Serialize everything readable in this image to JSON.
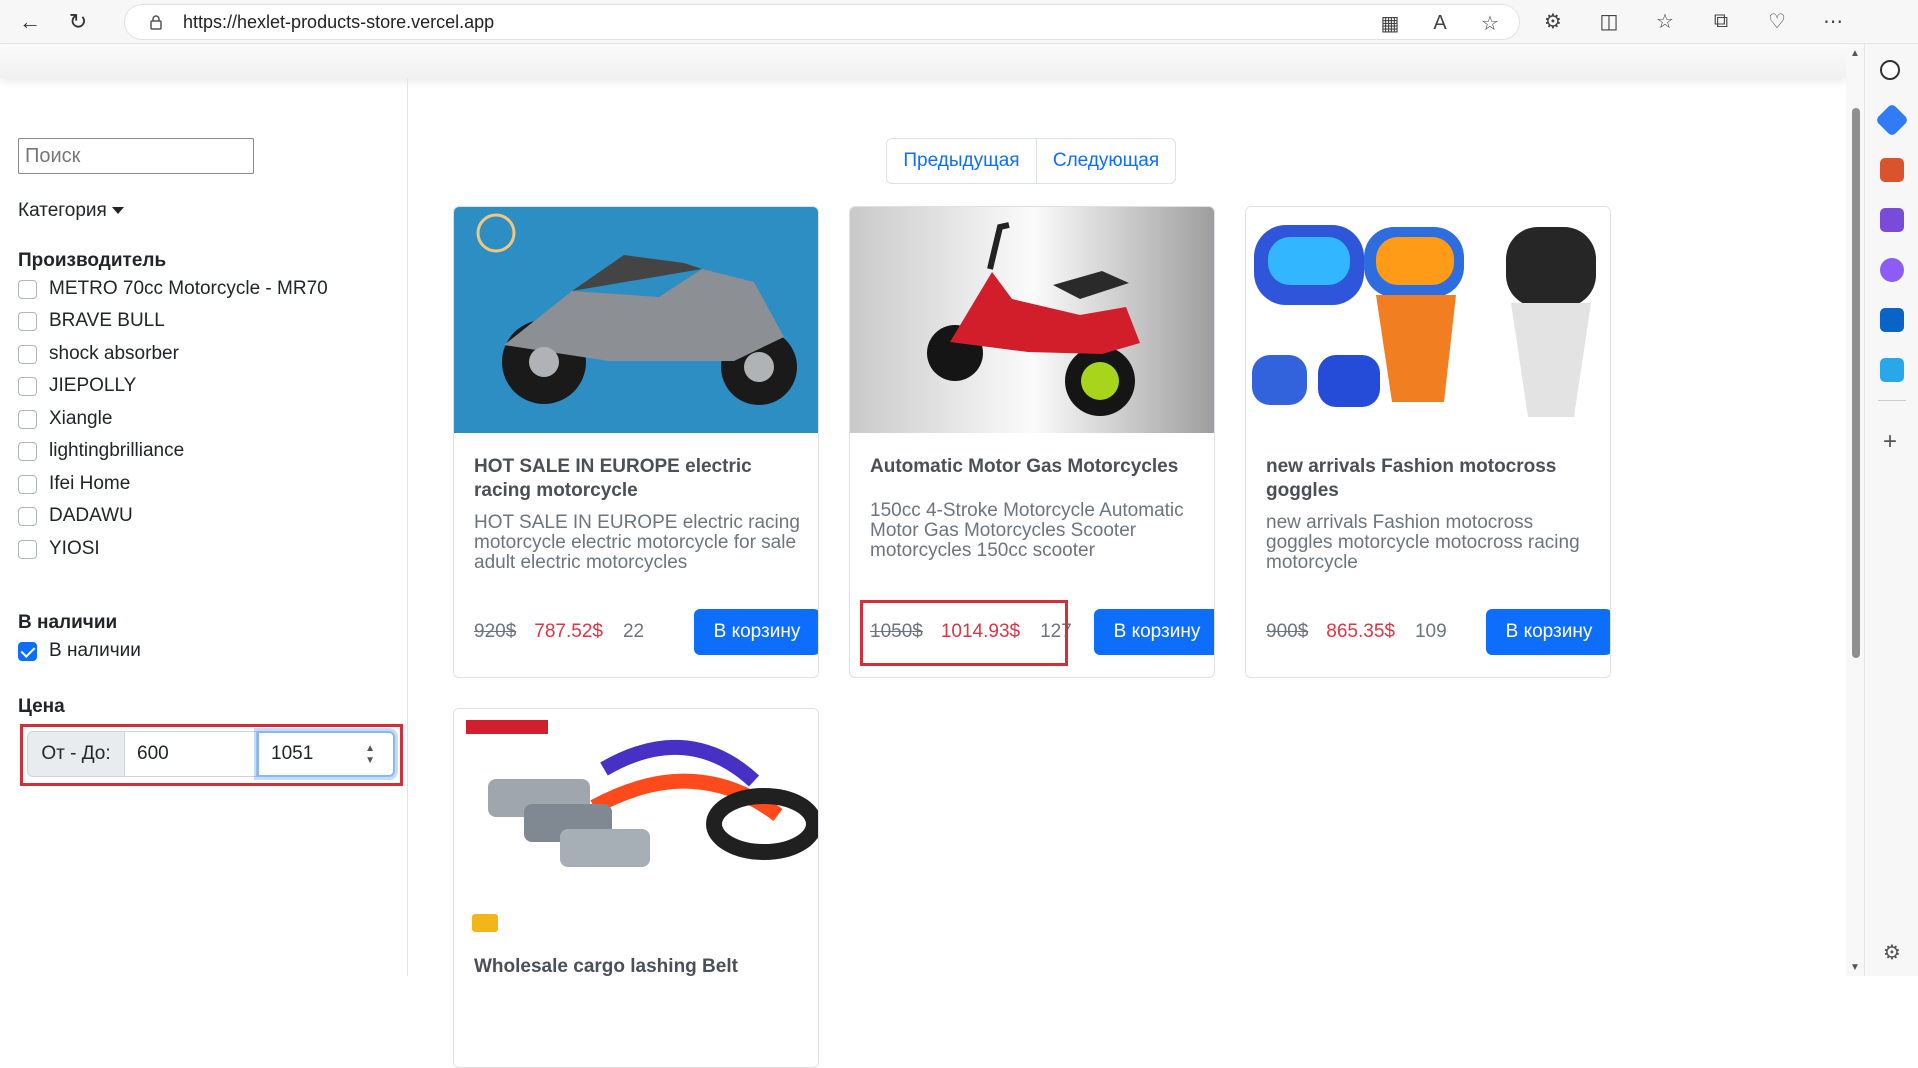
{
  "browser": {
    "url": "https://hexlet-products-store.vercel.app",
    "back_icon": "back-arrow-icon",
    "refresh_icon": "refresh-icon"
  },
  "sidebar": {
    "search_placeholder": "Поиск",
    "category_label": "Категория",
    "manufacturer_title": "Производитель",
    "manufacturers": [
      "METRO 70cc Motorcycle - MR70",
      "BRAVE BULL",
      "shock absorber",
      "JIEPOLLY",
      "Xiangle",
      "lightingbrilliance",
      "Ifei Home",
      "DADAWU",
      "YIOSI"
    ],
    "availability_title": "В наличии",
    "availability_option": "В наличии",
    "price_title": "Цена",
    "price_label": "От - До:",
    "price_from": "600",
    "price_to": "1051"
  },
  "pagination": {
    "previous": "Предыдущая",
    "next": "Следующая"
  },
  "products": [
    {
      "title": "HOT SALE IN EUROPE electric racing motorcycle",
      "description": "HOT SALE IN EUROPE electric racing motorcycle electric motorcycle for sale adult electric motorcycles",
      "old_price": "920$",
      "price": "787.52$",
      "stock": "22",
      "button": "В корзину"
    },
    {
      "title": "Automatic Motor Gas Motorcycles",
      "description": "150cc 4-Stroke Motorcycle Automatic Motor Gas Motorcycles Scooter motorcycles 150cc scooter",
      "old_price": "1050$",
      "price": "1014.93$",
      "stock": "127",
      "button": "В корзину"
    },
    {
      "title": "new arrivals Fashion motocross goggles",
      "description": "new arrivals Fashion motocross goggles motorcycle motocross racing motorcycle",
      "old_price": "900$",
      "price": "865.35$",
      "stock": "109",
      "button": "В корзину"
    },
    {
      "title": "Wholesale cargo lashing Belt"
    }
  ],
  "colors": {
    "primary": "#0d6efd",
    "price": "#dc3545",
    "highlight": "#d32f3a"
  }
}
